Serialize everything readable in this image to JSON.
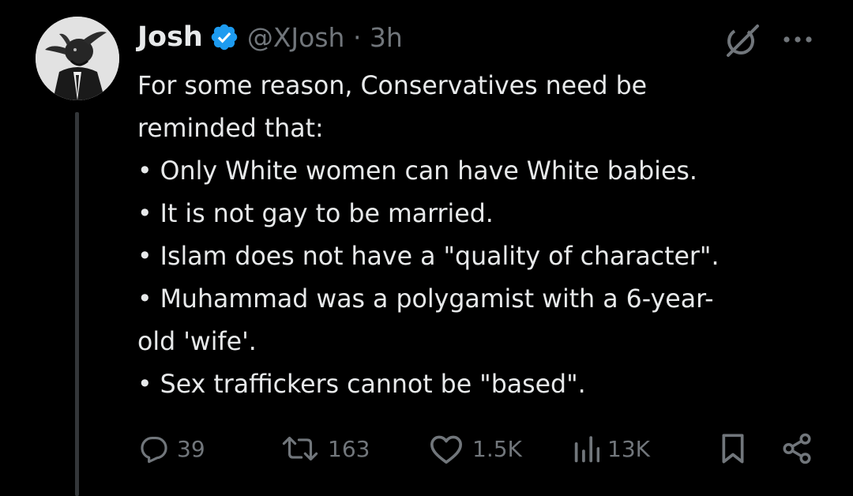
{
  "tweet": {
    "author_name": "Josh",
    "handle_time": "@XJosh · 3h",
    "lines": [
      "For some reason, Conservatives need be",
      "reminded that:",
      "• Only White women can have White babies.",
      "• It is not gay to be married.",
      "• Islam does not have a \"quality of character\".",
      "• Muhammad was a polygamist with a 6-year-",
      "old 'wife'.",
      "• Sex traffickers cannot be \"based\"."
    ]
  },
  "actions": {
    "replies": "39",
    "reposts": "163",
    "likes": "1.5K",
    "views": "13K"
  },
  "icons": {
    "verified": "verified-badge-icon",
    "grok": "grok-icon",
    "more": "more-icon",
    "reply": "reply-icon",
    "repost": "repost-icon",
    "like": "like-icon",
    "views": "views-icon",
    "bookmark": "bookmark-icon",
    "share": "share-icon"
  },
  "colors": {
    "background": "#000000",
    "text_primary": "#e7e9ea",
    "text_secondary": "#71767b",
    "verified_blue": "#1d9bf0"
  }
}
